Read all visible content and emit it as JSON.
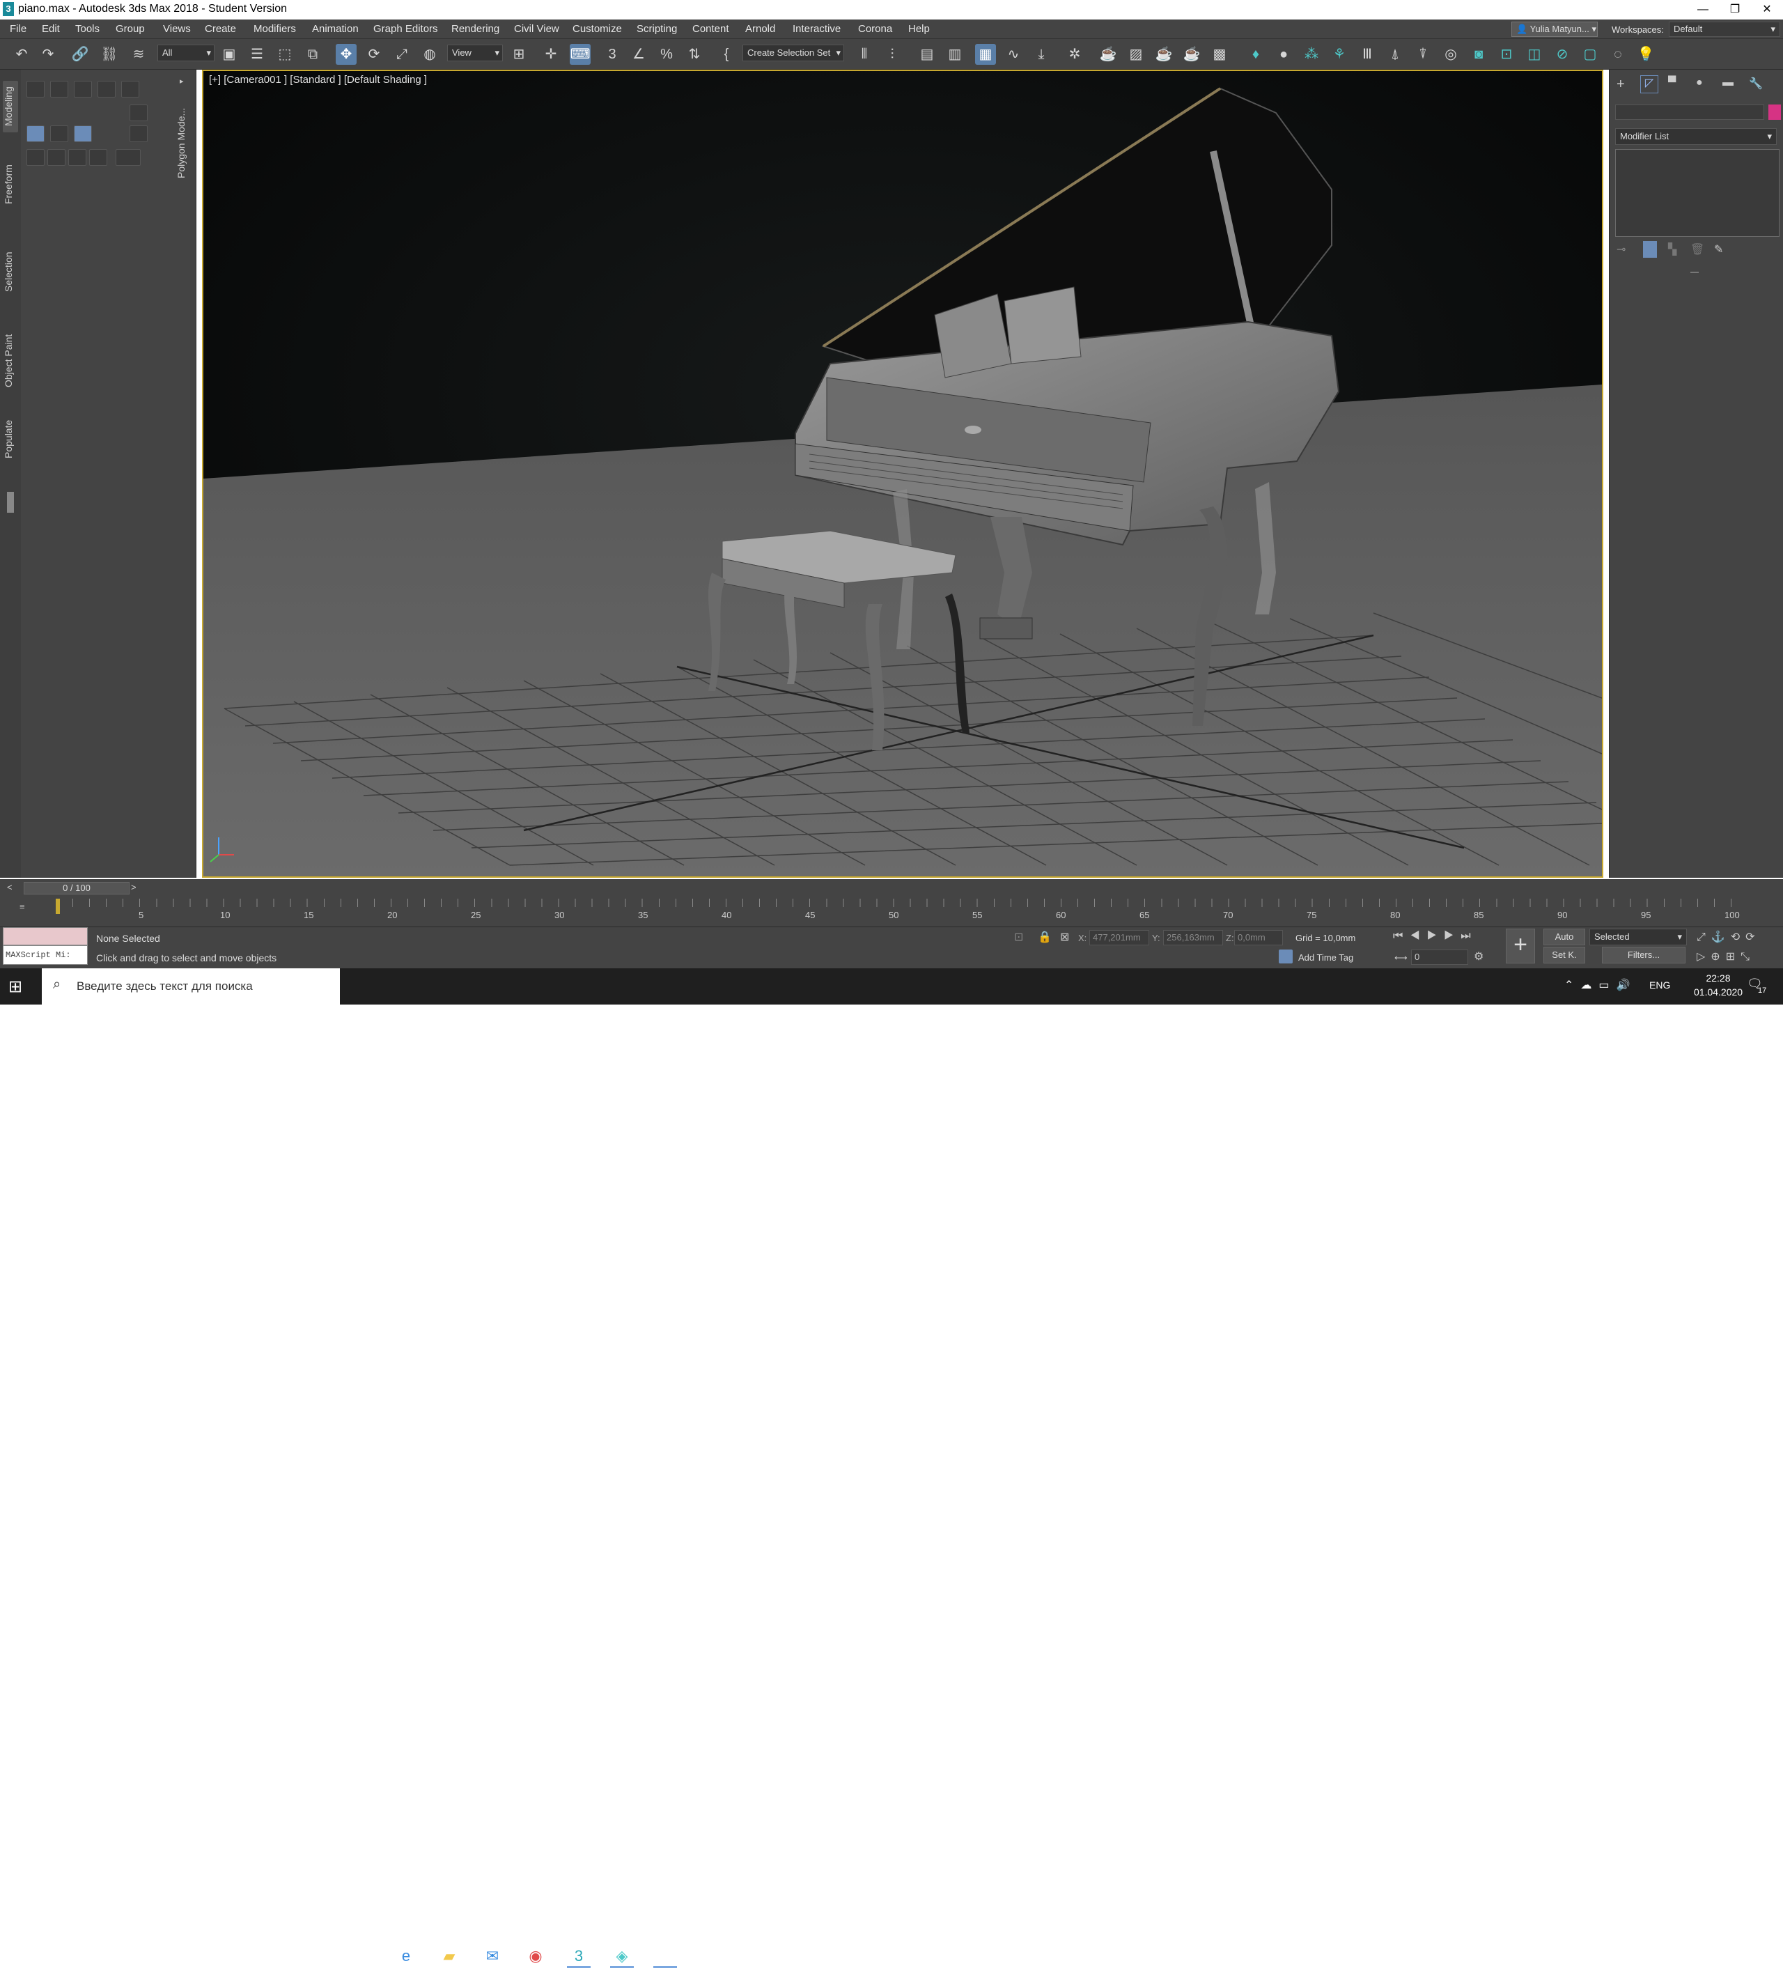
{
  "window": {
    "title": "piano.max - Autodesk 3ds Max 2018 - Student Version",
    "app_icon": "3",
    "min": "—",
    "max": "❐",
    "close": "✕"
  },
  "menu": [
    "File",
    "Edit",
    "Tools",
    "Group",
    "Views",
    "Create",
    "Modifiers",
    "Animation",
    "Graph Editors",
    "Rendering",
    "Civil View",
    "Customize",
    "Scripting",
    "Content",
    "Arnold",
    "Interactive",
    "Corona",
    "Help"
  ],
  "user": "Yulia Matyun...",
  "workspaces_label": "Workspaces:",
  "workspace": "Default",
  "toolbar": {
    "filter": "All",
    "ref_coord": "View",
    "selection_set": "Create Selection Set"
  },
  "ribbon": {
    "polygon_modeling": "Polygon Mode...",
    "tabs": [
      "Modeling",
      "Freeform",
      "Selection",
      "Object Paint",
      "Populate"
    ]
  },
  "viewport": {
    "label": "[+] [Camera001 ] [Standard ] [Default Shading ]",
    "border_color": "#c8a930"
  },
  "command_panel": {
    "modifier_list": "Modifier List",
    "color_swatch": "#d63384"
  },
  "timeline": {
    "frame": "0 / 100",
    "ticks": [
      "5",
      "10",
      "15",
      "20",
      "25",
      "30",
      "35",
      "40",
      "45",
      "50",
      "55",
      "60",
      "65",
      "70",
      "75",
      "80",
      "85",
      "90",
      "95",
      "100"
    ],
    "prev": "<",
    "next": ">"
  },
  "status": {
    "maxscript": "MAXScript Mi:",
    "selection": "None Selected",
    "prompt": "Click and drag to select and move objects",
    "x_label": "X:",
    "x_value": "477,201mm",
    "y_label": "Y:",
    "y_value": "256,163mm",
    "z_label": "Z:",
    "z_value": "0,0mm",
    "grid": "Grid = 10,0mm",
    "add_time_tag": "Add Time Tag",
    "auto": "Auto",
    "set_key": "Set K.",
    "key_filter": "Selected",
    "filters": "Filters...",
    "frame_spinner": "0"
  },
  "taskbar": {
    "search_placeholder": "Введите здесь текст для поиска",
    "lang": "ENG",
    "time": "22:28",
    "date": "01.04.2020",
    "notifications": "17"
  }
}
